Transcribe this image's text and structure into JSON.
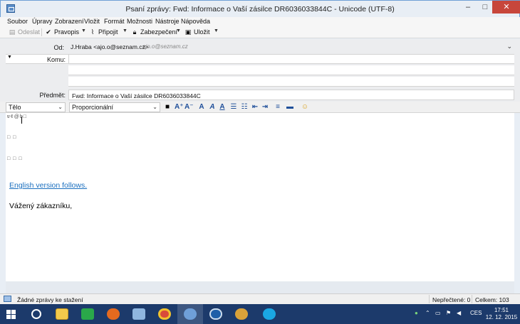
{
  "window": {
    "title": "Psaní zprávy: Fwd: Informace o Vaší zásilce DR6036033844C - Unicode (UTF-8)",
    "minimize": "–",
    "maximize": "□",
    "close": "✕"
  },
  "menu": [
    "Soubor",
    "Úpravy",
    "Zobrazení",
    "Vložit",
    "Formát",
    "Možnosti",
    "Nástroje",
    "Nápověda"
  ],
  "toolbar": {
    "send": "Odeslat",
    "spelling": "Pravopis",
    "attach": "Připojit",
    "security": "Zabezpečení",
    "save": "Uložit"
  },
  "headers": {
    "from_label": "Od:",
    "from_value": "J.Hraba <ajo.o@seznam.cz>",
    "from_hint": "ajo.o@seznam.cz",
    "to_label": "Komu:",
    "subject_label": "Předmět:",
    "subject_value": "Fwd: Informace o Vaší zásilce DR6036033844C"
  },
  "format": {
    "paragraph": "Tělo",
    "font": "Proporcionální"
  },
  "body": {
    "marks1": "ɐ¢@b□",
    "marks2": "□   □",
    "marks3": "□  □  □",
    "link": "English version follows.",
    "greeting": "Vážený zákazníku,"
  },
  "status": {
    "message": "Žádné zprávy ke stažení",
    "unread": "Nepřečtené: 0",
    "total": "Celkem: 103"
  },
  "taskbar": {
    "lang": "CES",
    "time": "17:51",
    "date": "12. 12. 2015",
    "apps": [
      "start-button",
      "task-view",
      "file-explorer",
      "store",
      "firefox",
      "paint",
      "chrome",
      "thunderbird",
      "app-blue",
      "app-box",
      "skype"
    ]
  }
}
